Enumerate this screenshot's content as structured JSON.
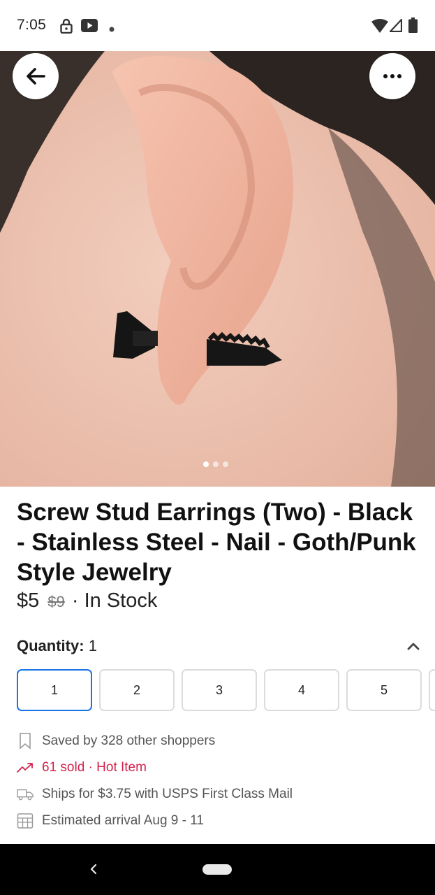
{
  "status_bar": {
    "time": "7:05",
    "left_icons": [
      "lock-icon",
      "youtube-icon",
      "notification-dot-icon"
    ],
    "right_icons": [
      "wifi-icon",
      "signal-icon",
      "battery-icon"
    ]
  },
  "gallery": {
    "image_description_icon": "product-photo",
    "page_count": 3,
    "active_index": 0
  },
  "product": {
    "title": "Screw Stud Earrings (Two) - Black - Stainless Steel - Nail - Goth/Punk Style Jewelry",
    "price": "$5",
    "original_price": "$9",
    "stock_status": "· In Stock"
  },
  "quantity": {
    "label": "Quantity:",
    "value": "1",
    "options": [
      "1",
      "2",
      "3",
      "4",
      "5"
    ],
    "selected": "1"
  },
  "details": {
    "saved": "Saved by 328 other shoppers",
    "sold": "61 sold · Hot Item",
    "shipping": "Ships for $3.75 with USPS First Class Mail",
    "arrival": "Estimated arrival Aug 9 - 11"
  },
  "colors": {
    "accent_blue": "#1a73e8",
    "hot_red": "#d3224b"
  }
}
